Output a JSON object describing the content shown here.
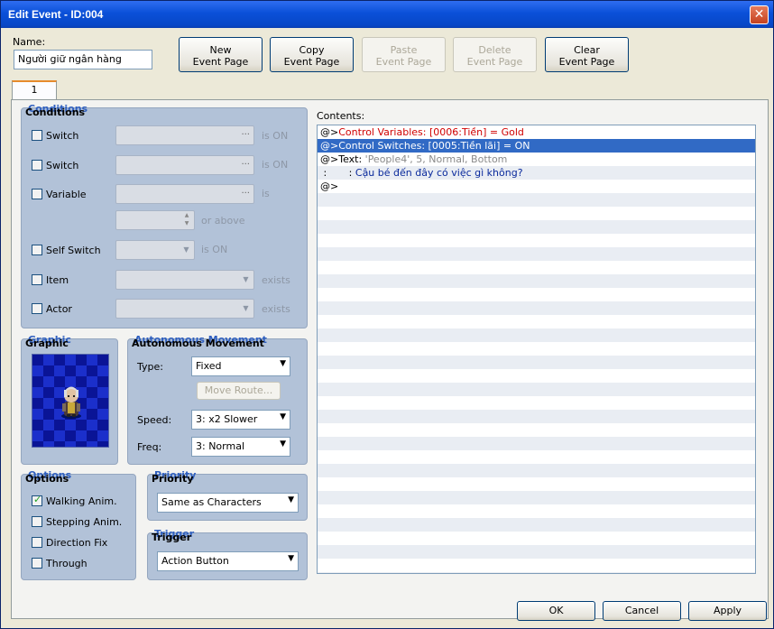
{
  "window": {
    "title": "Edit Event - ID:004",
    "close_glyph": "✕"
  },
  "name": {
    "label": "Name:",
    "value": "Người giữ ngân hàng"
  },
  "toolbar": {
    "new": [
      "New",
      "Event Page"
    ],
    "copy": [
      "Copy",
      "Event Page"
    ],
    "paste": [
      "Paste",
      "Event Page"
    ],
    "delete": [
      "Delete",
      "Event Page"
    ],
    "clear": [
      "Clear",
      "Event Page"
    ]
  },
  "tab": {
    "label": "1"
  },
  "conditions": {
    "title": "Conditions",
    "switch1": {
      "label": "Switch",
      "suffix": "is ON"
    },
    "switch2": {
      "label": "Switch",
      "suffix": "is ON"
    },
    "variable": {
      "label": "Variable",
      "suffix": "is",
      "or_above": "or above"
    },
    "self_switch": {
      "label": "Self Switch",
      "suffix": "is ON"
    },
    "item": {
      "label": "Item",
      "suffix": "exists"
    },
    "actor": {
      "label": "Actor",
      "suffix": "exists"
    },
    "dots": "..."
  },
  "graphic": {
    "title": "Graphic"
  },
  "movement": {
    "title": "Autonomous Movement",
    "type_label": "Type:",
    "type_value": "Fixed",
    "move_route": "Move Route...",
    "speed_label": "Speed:",
    "speed_value": "3: x2 Slower",
    "freq_label": "Freq:",
    "freq_value": "3: Normal"
  },
  "options": {
    "title": "Options",
    "walking": "Walking Anim.",
    "stepping": "Stepping Anim.",
    "direction": "Direction Fix",
    "through": "Through"
  },
  "priority": {
    "title": "Priority",
    "value": "Same as Characters"
  },
  "trigger": {
    "title": "Trigger",
    "value": "Action Button"
  },
  "contents": {
    "label": "Contents:",
    "rows": [
      {
        "prefix": "@>",
        "text": "Control Variables: [0006:Tiền] = Gold"
      },
      {
        "prefix": "@>",
        "text": "Control Switches: [0005:Tiền lãi] = ON"
      },
      {
        "prefix": "@>",
        "text": "Text: ",
        "extra": "'People4', 5, Normal, Bottom"
      },
      {
        "prefix": " :       : ",
        "text": "Cậu bé đến đây có việc gì không?"
      },
      {
        "prefix": "@>",
        "text": ""
      }
    ]
  },
  "footer": {
    "ok": "OK",
    "cancel": "Cancel",
    "apply": "Apply"
  }
}
